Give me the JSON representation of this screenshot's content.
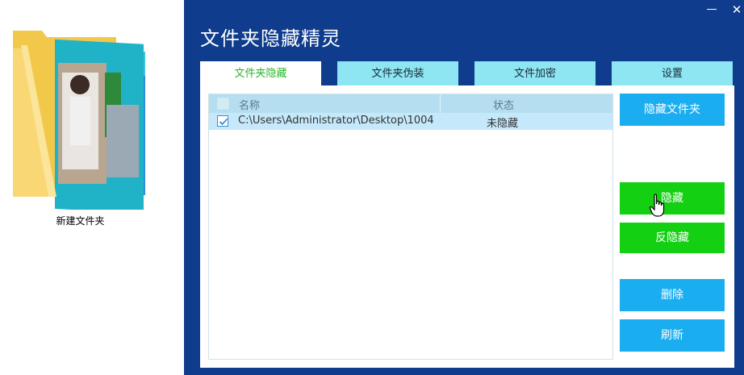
{
  "desktop": {
    "folder_label": "新建文件夹"
  },
  "window": {
    "title": "文件夹隐藏精灵",
    "minimize_glyph": "—",
    "close_glyph": "✕"
  },
  "tabs": [
    {
      "label": "文件夹隐藏",
      "active": true
    },
    {
      "label": "文件夹伪装",
      "active": false
    },
    {
      "label": "文件加密",
      "active": false
    },
    {
      "label": "设置",
      "active": false
    }
  ],
  "list": {
    "columns": [
      "名称",
      "状态"
    ],
    "rows": [
      {
        "checked": true,
        "path": "C:\\Users\\Administrator\\Desktop\\1004",
        "status": "未隐藏"
      }
    ]
  },
  "buttons": {
    "hide_folder": "隐藏文件夹",
    "hide": "隐藏",
    "unhide": "反隐藏",
    "delete": "删除",
    "refresh": "刷新"
  },
  "colors": {
    "window_bg": "#0f3c8c",
    "tab_inactive": "#8de6f2",
    "tab_active_text": "#2ab52a",
    "button_blue": "#1aaef0",
    "button_green": "#13d013",
    "row_selected": "#c5e8fa",
    "header_bg": "#b5dff0"
  },
  "icons": {
    "folder": "folder-with-photos-icon",
    "checkbox": "checkbox-checked-icon",
    "cursor": "hand-pointer-icon"
  }
}
